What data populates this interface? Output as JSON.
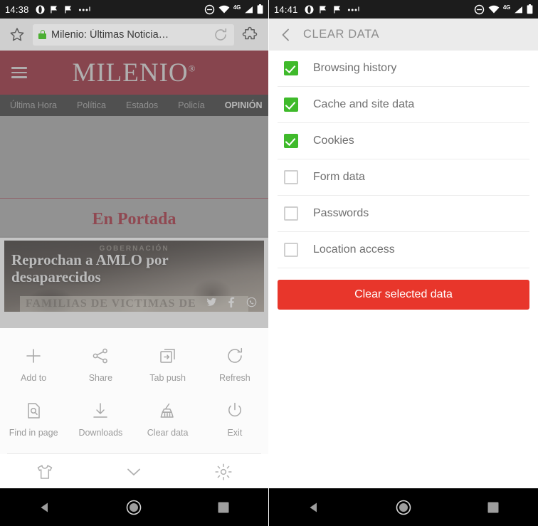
{
  "left_phone": {
    "status_bar": {
      "time": "14:38",
      "left_icons": [
        "opera-icon",
        "flag-icon",
        "flag-icon",
        "more-dots-icon"
      ],
      "right_icons": [
        "do-not-disturb-icon",
        "wifi-icon",
        "signal-icon",
        "battery-icon"
      ],
      "network_label": "4G"
    },
    "browser_bar": {
      "bookmark_icon": "star-icon",
      "secure_icon": "lock-icon",
      "page_title": "Milenio: Últimas Noticia…",
      "reload_icon": "refresh-icon",
      "extension_icon": "puzzle-icon"
    },
    "website": {
      "brand": "MILENIO",
      "brand_mark": "®",
      "menu_icon": "hamburger-icon",
      "nav_items": [
        {
          "label": "Última Hora",
          "active": false
        },
        {
          "label": "Política",
          "active": false
        },
        {
          "label": "Estados",
          "active": false
        },
        {
          "label": "Policía",
          "active": false
        },
        {
          "label": "OPINIÓN",
          "active": true
        }
      ],
      "section_heading": "En Portada",
      "hero": {
        "kicker": "GOBERNACIÓN",
        "headline": "Reprochan a AMLO por desaparecidos",
        "banner_text": "FAMILIAS DE VICTIMAS DE",
        "social_icons": [
          "twitter-icon",
          "facebook-icon",
          "whatsapp-icon"
        ]
      }
    },
    "opera_menu": {
      "items": [
        {
          "label": "Add to",
          "icon": "plus-icon"
        },
        {
          "label": "Share",
          "icon": "share-icon"
        },
        {
          "label": "Tab push",
          "icon": "tab-push-icon"
        },
        {
          "label": "Refresh",
          "icon": "refresh-icon"
        },
        {
          "label": "Find in page",
          "icon": "find-in-page-icon"
        },
        {
          "label": "Downloads",
          "icon": "download-icon"
        },
        {
          "label": "Clear data",
          "icon": "broom-icon"
        },
        {
          "label": "Exit",
          "icon": "power-icon"
        }
      ],
      "bottom_icons": [
        "tshirt-icon",
        "chevron-down-icon",
        "gear-icon"
      ]
    },
    "android_nav": [
      "back-triangle-icon",
      "home-circle-icon",
      "recents-square-icon"
    ]
  },
  "right_phone": {
    "status_bar": {
      "time": "14:41",
      "left_icons": [
        "opera-icon",
        "flag-icon",
        "flag-icon",
        "more-dots-icon"
      ],
      "right_icons": [
        "do-not-disturb-icon",
        "wifi-icon",
        "signal-icon",
        "battery-icon"
      ],
      "network_label": "4G"
    },
    "header": {
      "back_icon": "chevron-left-icon",
      "title": "CLEAR DATA"
    },
    "options": [
      {
        "label": "Browsing history",
        "checked": true
      },
      {
        "label": "Cache and site data",
        "checked": true
      },
      {
        "label": "Cookies",
        "checked": true
      },
      {
        "label": "Form data",
        "checked": false
      },
      {
        "label": "Passwords",
        "checked": false
      },
      {
        "label": "Location access",
        "checked": false
      }
    ],
    "primary_button": "Clear selected data",
    "android_nav": [
      "back-triangle-icon",
      "home-circle-icon",
      "recents-square-icon"
    ]
  },
  "colors": {
    "milenio_red": "#8c1323",
    "portada_red": "#9e1b2c",
    "checkbox_green": "#3fba2b",
    "clear_button_red": "#e8362b",
    "header_grey": "#ebebeb"
  }
}
